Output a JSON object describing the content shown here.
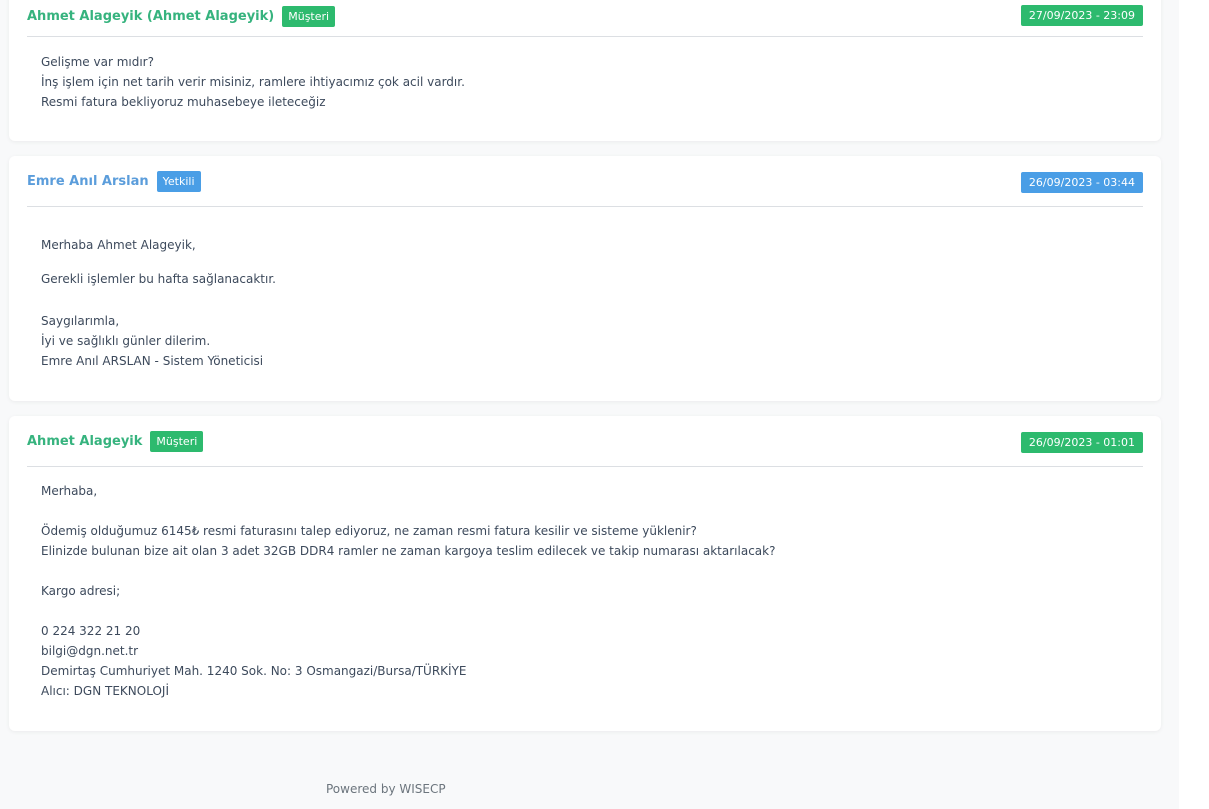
{
  "messages": [
    {
      "author": "Ahmet Alageyik (Ahmet Alageyik)",
      "role_badge": "Müşteri",
      "date": "27/09/2023 - 23:09",
      "lines": [
        "Gelişme var mıdır?",
        "İnş işlem için net tarih verir misiniz, ramlere ihtiyacımız çok acil vardır.",
        "Resmi fatura bekliyoruz muhasebeye ileteceğiz"
      ]
    },
    {
      "author": "Emre Anıl Arslan",
      "role_badge": "Yetkili",
      "date": "26/09/2023 - 03:44",
      "lines": [
        "Merhaba Ahmet Alageyik,",
        "Gerekli işlemler bu hafta sağlanacaktır.",
        "Saygılarımla,",
        "İyi ve sağlıklı günler dilerim.",
        "Emre Anıl ARSLAN - Sistem Yöneticisi"
      ]
    },
    {
      "author": "Ahmet Alageyik",
      "role_badge": "Müşteri",
      "date": "26/09/2023 - 01:01",
      "lines": [
        "Merhaba,",
        "Ödemiş olduğumuz 6145₺ resmi faturasını talep ediyoruz, ne zaman resmi fatura kesilir ve sisteme yüklenir?",
        "Elinizde bulunan bize ait olan 3 adet 32GB DDR4 ramler ne zaman kargoya teslim edilecek ve takip numarası aktarılacak?",
        "Kargo adresi;",
        "0 224 322 21 20",
        "bilgi@dgn.net.tr",
        "Demirtaş Cumhuriyet Mah. 1240 Sok. No: 3 Osmangazi/Bursa/TÜRKİYE",
        "Alıcı: DGN TEKNOLOJİ"
      ]
    }
  ],
  "footer": {
    "text": "Powered by WISECP"
  },
  "colors": {
    "customer_green": "#2dba6e",
    "staff_blue": "#4a9ee6",
    "customer_name": "#36b37e",
    "staff_name": "#5b9ddb",
    "body_text": "#3d4a5c",
    "divider": "#dcdfe3",
    "page_bg": "#f8f9fa"
  }
}
